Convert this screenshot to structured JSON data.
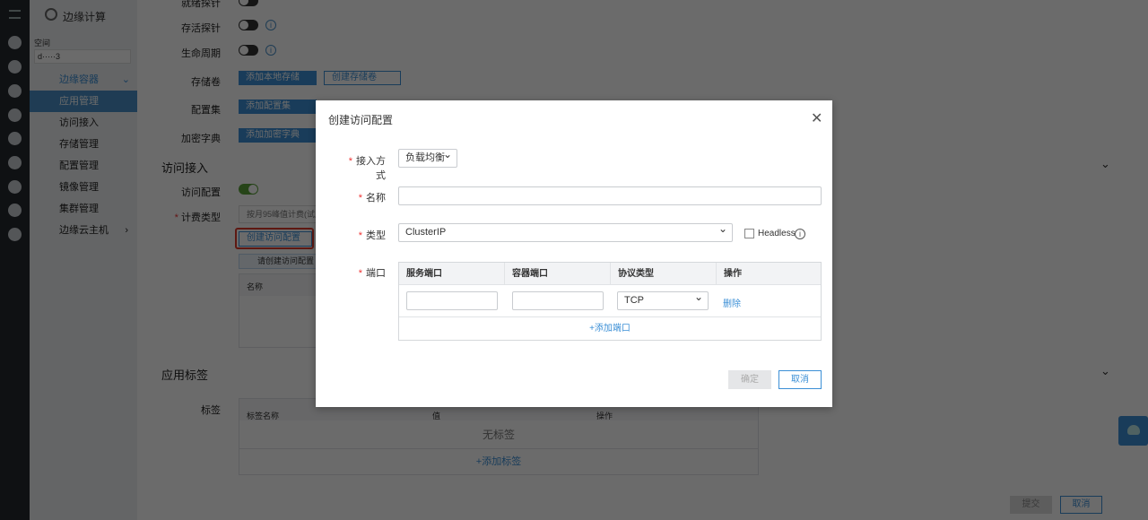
{
  "nav": {
    "product": "边缘计算",
    "space_label": "空间",
    "space_value": "d·····3",
    "groups": [
      {
        "label": "边缘容器",
        "items": [
          "应用管理",
          "访问接入",
          "存储管理",
          "配置管理",
          "镜像管理",
          "集群管理"
        ]
      },
      {
        "label": "边缘云主机"
      }
    ],
    "active": "应用管理"
  },
  "form": {
    "probe_ready": "就绪探针",
    "probe_live": "存活探针",
    "lifecycle": "生命周期",
    "volume": "存储卷",
    "add_local_storage": "添加本地存储",
    "create_volume": "创建存储卷",
    "configset": "配置集",
    "add_configset": "添加配置集",
    "secret": "加密字典",
    "add_secret": "添加加密字典",
    "access_section": "访问接入",
    "access_config": "访问配置",
    "billing": "计费类型",
    "billing_value": "按月95峰值计费(试用)",
    "create_access": "创建访问配置",
    "access_hint": "请创建访问配置",
    "access_col_name": "名称",
    "labels_section": "应用标签",
    "labels_label": "标签",
    "labels_cols": [
      "标签名称",
      "值",
      "操作"
    ],
    "no_labels": "无标签",
    "add_label": "+添加标签",
    "submit": "提交",
    "cancel": "取消"
  },
  "modal": {
    "title": "创建访问配置",
    "access_method_label": "接入方式",
    "access_method_value": "负载均衡",
    "name_label": "名称",
    "name_value": "",
    "type_label": "类型",
    "type_value": "ClusterIP",
    "headless_label": "Headless",
    "headless_checked": false,
    "port_label": "端口",
    "port_columns": [
      "服务端口",
      "容器端口",
      "协议类型",
      "操作"
    ],
    "port_rows": [
      {
        "service_port": "",
        "container_port": "",
        "protocol": "TCP",
        "action": "删除"
      }
    ],
    "add_port": "+添加端口",
    "confirm": "确定",
    "cancel": "取消"
  },
  "colors": {
    "primary": "#3b8fd6",
    "toggle_on": "#5aa13a",
    "highlight": "#e0392b"
  }
}
